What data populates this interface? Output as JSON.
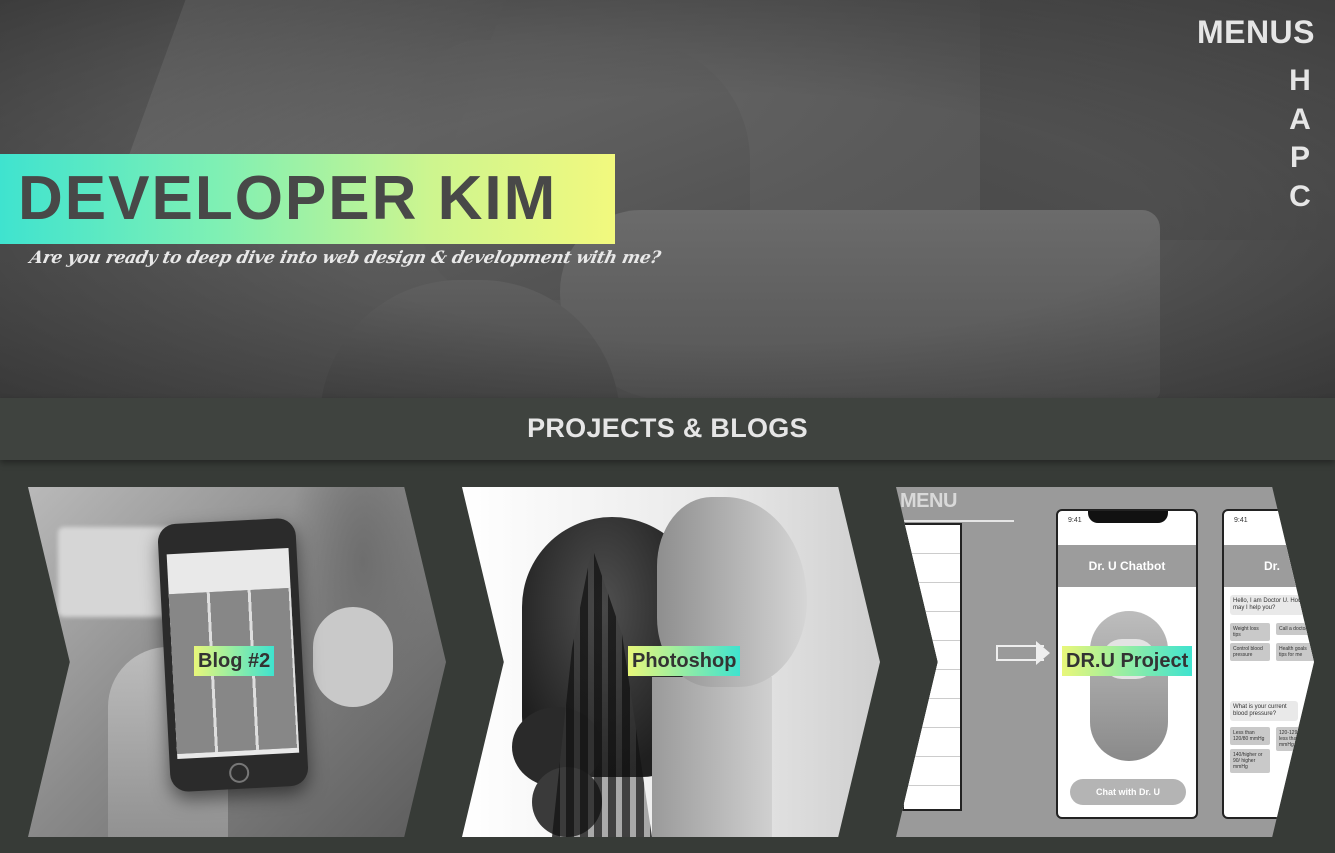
{
  "hero": {
    "title": "DEVELOPER KIM",
    "tagline": "Are you ready to deep dive into web design & development with me?"
  },
  "menu": {
    "title": "MENUS",
    "items": [
      {
        "label": "H"
      },
      {
        "label": "A"
      },
      {
        "label": "P"
      },
      {
        "label": "C"
      }
    ]
  },
  "section": {
    "title": "PROJECTS & BLOGS"
  },
  "cards": [
    {
      "label": "Blog #2"
    },
    {
      "label": "Photoshop"
    },
    {
      "label": "DR.U Project",
      "mockup": {
        "menu_word": "MENU",
        "phone_time": "9:41",
        "app_title": "Dr. U Chatbot",
        "button_label": "Chat with Dr. U",
        "second_title": "Dr.",
        "msg1": "Hello, I am Doctor U. How may I help you?",
        "msg2": "What is your current blood pressure?",
        "chip1": "Weight loss tips",
        "chip2": "Call a doctor",
        "chip3": "Control blood pressure",
        "chip4": "Health goals tips for me",
        "chip5": "Less than 120/80 mmHg",
        "chip6": "120-129 and less than 80 mmHg",
        "chip7": "140/higher or 90/ higher mmHg"
      }
    }
  ],
  "colors": {
    "accent_start": "#3fe3cf",
    "accent_end": "#f2f97e",
    "background": "#373b37",
    "section_bar": "#3f433f"
  }
}
